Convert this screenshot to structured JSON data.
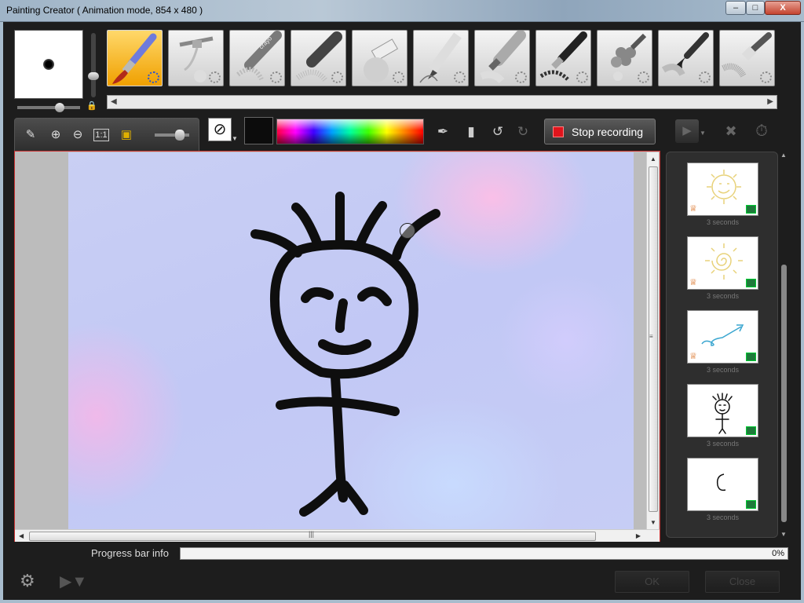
{
  "window": {
    "title": "Painting Creator ( Animation mode, 854 x 480 )",
    "minimize_glyph": "–",
    "maximize_glyph": "□",
    "close_glyph": "X"
  },
  "tools": [
    {
      "name": "paintbrush-tool",
      "icon": "paintbrush-icon",
      "active": true
    },
    {
      "name": "airbrush-tool",
      "icon": "airbrush-icon",
      "active": false
    },
    {
      "name": "crayon-tool",
      "icon": "crayon-icon",
      "active": false,
      "label": "crayo"
    },
    {
      "name": "chalk-tool",
      "icon": "chalk-icon",
      "active": false
    },
    {
      "name": "charcoal-tool",
      "icon": "charcoal-icon",
      "active": false
    },
    {
      "name": "pencil-tool",
      "icon": "pencil-icon",
      "active": false
    },
    {
      "name": "marker-tool",
      "icon": "marker-icon",
      "active": false
    },
    {
      "name": "oil-brush-tool",
      "icon": "oil-brush-icon",
      "active": false
    },
    {
      "name": "stamp-tool",
      "icon": "stamp-icon",
      "active": false
    },
    {
      "name": "flat-brush-tool",
      "icon": "flat-brush-icon",
      "active": false
    },
    {
      "name": "bristle-brush-tool",
      "icon": "bristle-brush-icon",
      "active": false
    }
  ],
  "toolbar": {
    "stop_recording_label": "Stop recording"
  },
  "frames": [
    {
      "duration": "3 seconds",
      "thumb": "sun-face",
      "crown": true
    },
    {
      "duration": "3 seconds",
      "thumb": "sun-spiral",
      "crown": true
    },
    {
      "duration": "3 seconds",
      "thumb": "arrow",
      "crown": true
    },
    {
      "duration": "3 seconds",
      "thumb": "stick-figure",
      "crown": false
    },
    {
      "duration": "3 seconds",
      "thumb": "partial-head",
      "crown": false
    }
  ],
  "progress": {
    "label": "Progress bar info",
    "percent": 0,
    "percent_text": "0%"
  },
  "footer": {
    "ok_label": "OK",
    "close_label": "Close"
  },
  "colors": {
    "selected_color": "#0c0c0c",
    "accent_active_tool": "#f0a000",
    "record_red": "#e0141c"
  }
}
